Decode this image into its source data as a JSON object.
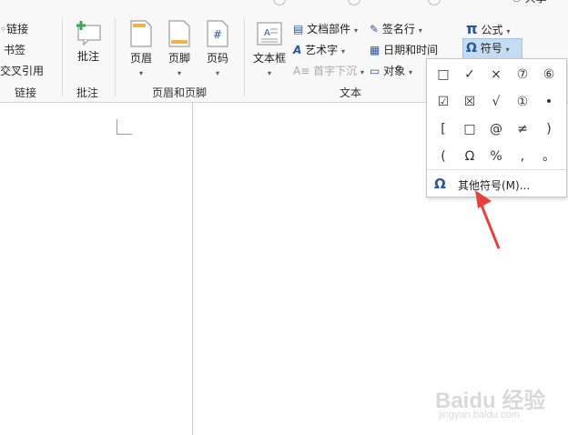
{
  "links": {
    "items": [
      "链接",
      "书签",
      "交叉引用"
    ],
    "group_label": "链接"
  },
  "comments": {
    "button": "批注",
    "group_label": "批注"
  },
  "header_footer": {
    "header": "页眉",
    "footer": "页脚",
    "page_number": "页码",
    "group_label": "页眉和页脚"
  },
  "text": {
    "textbox": "文本框",
    "quick_parts": "文档部件",
    "wordart": "艺术字",
    "dropcap": "首字下沉",
    "signature": "签名行",
    "datetime": "日期和时间",
    "object": "对象",
    "group_label": "文本"
  },
  "symbols": {
    "equation": "公式",
    "symbol": "符号"
  },
  "top_right": {
    "share": "共享"
  },
  "dropdown": {
    "symbols": [
      "□",
      "✓",
      "×",
      "⑦",
      "⑥",
      "☑",
      "☒",
      "√",
      "①",
      "•",
      "[",
      "□",
      "@",
      "≠",
      ")",
      "(",
      "Ω",
      "%",
      ",",
      "。"
    ],
    "more_label": "其他符号(M)..."
  },
  "watermark": {
    "brand": "Baidu 经验",
    "url": "jingyan.baidu.com"
  },
  "colors": {
    "accent": "#2b579a",
    "arrow": "#e8413c"
  }
}
